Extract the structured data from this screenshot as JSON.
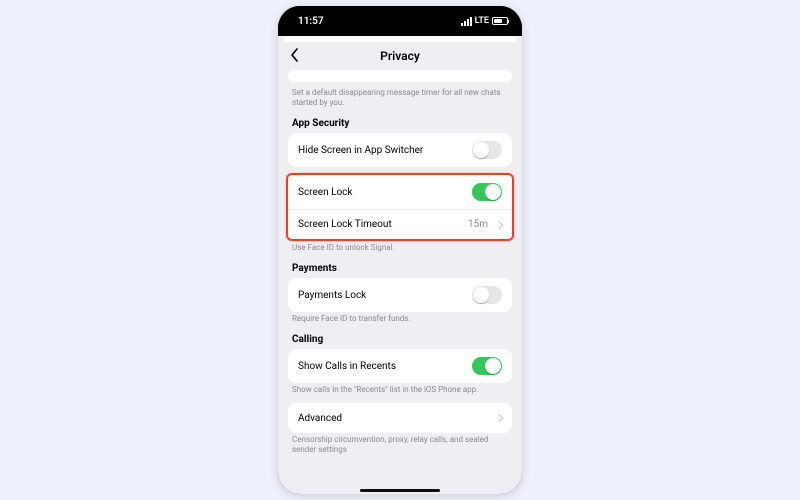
{
  "status": {
    "time": "11:57",
    "network": "LTE",
    "battery": "53"
  },
  "nav": {
    "title": "Privacy"
  },
  "disappearing_hint": "Set a default disappearing message timer for all new chats started by you.",
  "sections": {
    "security": {
      "title": "App Security",
      "hide_switcher": {
        "label": "Hide Screen in App Switcher",
        "on": false
      },
      "screen_lock": {
        "label": "Screen Lock",
        "on": true
      },
      "timeout": {
        "label": "Screen Lock Timeout",
        "value": "15m"
      },
      "footer": "Use Face ID to unlock Signal."
    },
    "payments": {
      "title": "Payments",
      "lock": {
        "label": "Payments Lock",
        "on": false
      },
      "footer": "Require Face ID to transfer funds."
    },
    "calling": {
      "title": "Calling",
      "recents": {
        "label": "Show Calls in Recents",
        "on": true
      },
      "footer": "Show calls in the \"Recents\" list in the iOS Phone app."
    },
    "advanced": {
      "label": "Advanced",
      "footer": "Censorship circumvention, proxy, relay calls, and sealed sender settings"
    }
  }
}
